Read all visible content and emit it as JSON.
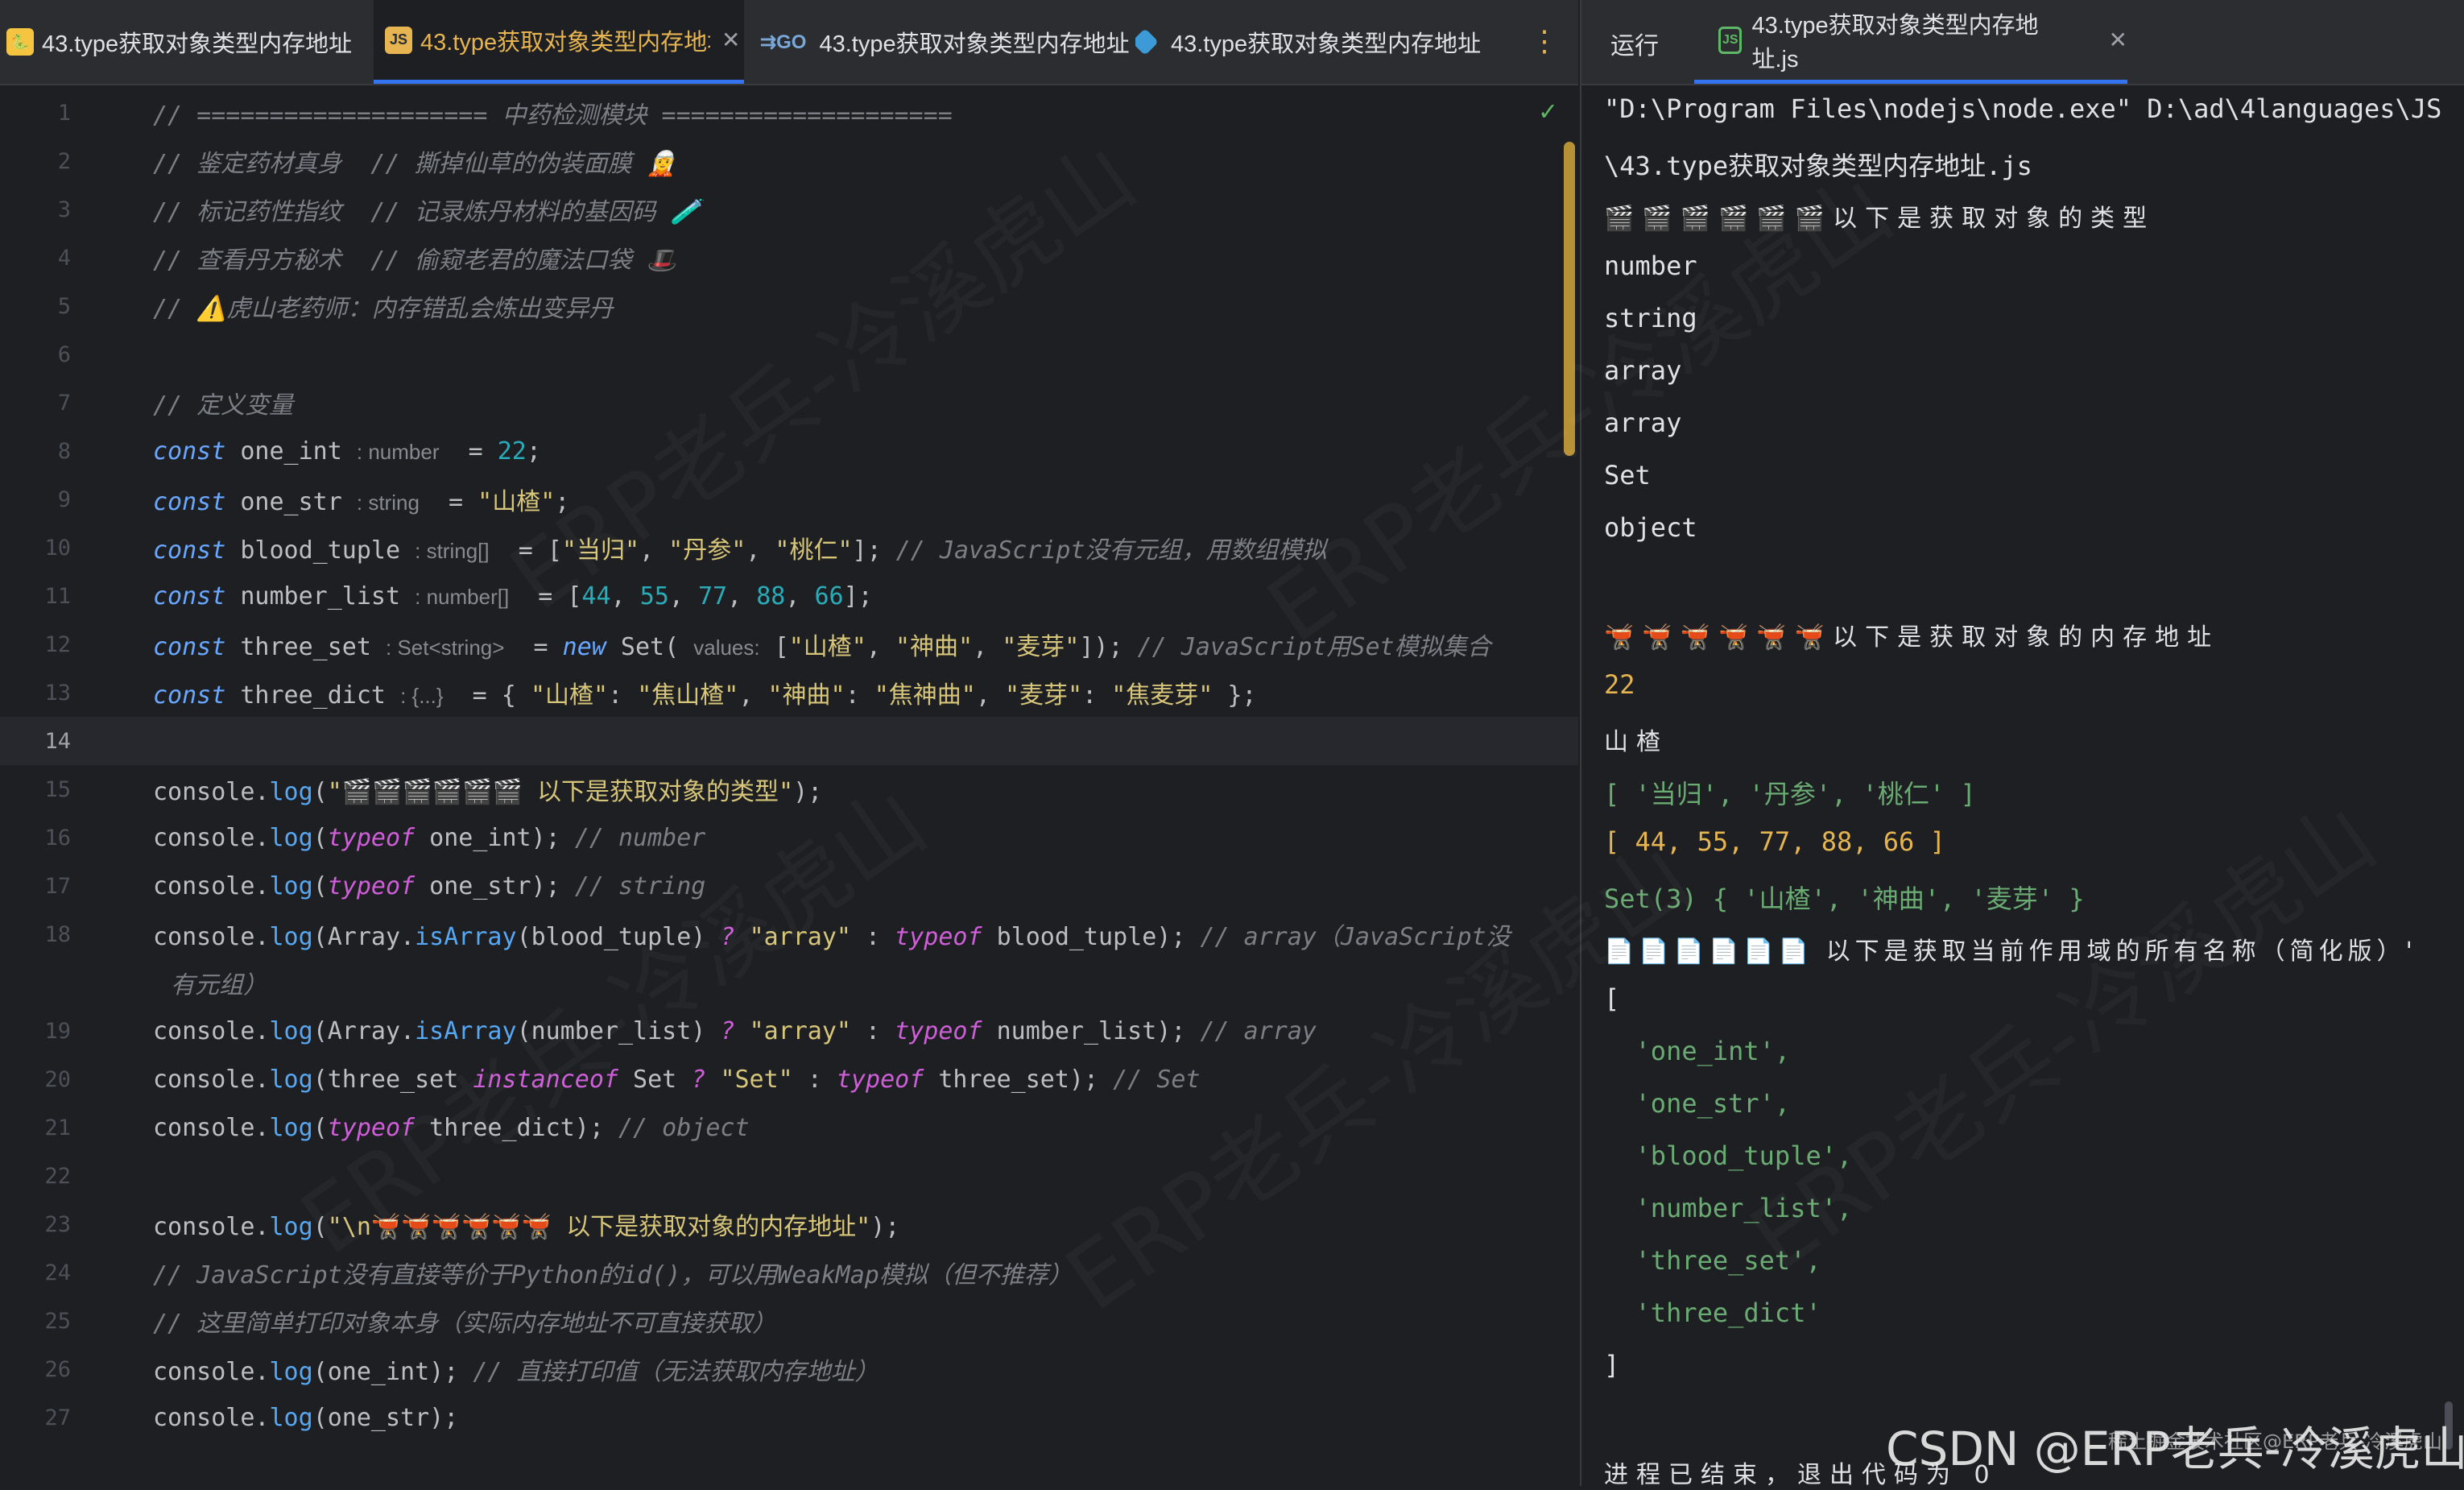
{
  "editor": {
    "tabs": [
      {
        "label": "43.type获取对象类型内存地址",
        "icon": "python-file-icon",
        "active": false,
        "closable": false
      },
      {
        "label": "43.type获取对象类型内存地址",
        "icon": "js-file-icon",
        "active": true,
        "closable": true
      },
      {
        "label": "43.type获取对象类型内存地址",
        "icon": "go-file-icon",
        "active": false,
        "closable": false
      },
      {
        "label": "43.type获取对象类型内存地址",
        "icon": "cube-file-icon",
        "active": false,
        "closable": false
      }
    ],
    "line_numbers": [
      "1",
      "2",
      "3",
      "4",
      "5",
      "6",
      "7",
      "8",
      "9",
      "10",
      "11",
      "12",
      "13",
      "14",
      "15",
      "16",
      "17",
      "18",
      "19",
      "20",
      "21",
      "22",
      "23",
      "24",
      "25",
      "26",
      "27"
    ],
    "current_line": "14",
    "code_lines": [
      "// ==================== 中药检测模块 ====================",
      "// 鉴定药材真身  // 撕掉仙草的伪装面膜 🧝",
      "// 标记药性指纹  // 记录炼丹材料的基因码 🧪",
      "// 查看丹方秘术  // 偷窥老君的魔法口袋 🎩",
      "// ⚠️虎山老药师：内存错乱会炼出变异丹",
      "",
      "// 定义变量",
      "const one_int = 22;",
      "const one_str = \"山楂\";",
      "const blood_tuple = [\"当归\", \"丹参\", \"桃仁\"]; // JavaScript没有元组，用数组模拟",
      "const number_list = [44, 55, 77, 88, 66];",
      "const three_set = new Set([\"山楂\", \"神曲\", \"麦芽\"]); // JavaScript用Set模拟集合",
      "const three_dict = { \"山楂\": \"焦山楂\", \"神曲\": \"焦神曲\", \"麦芽\": \"焦麦芽\" };",
      "",
      "console.log(\"🎬🎬🎬🎬🎬🎬 以下是获取对象的类型\");",
      "console.log(typeof one_int); // number",
      "console.log(typeof one_str); // string",
      "console.log(Array.isArray(blood_tuple) ? \"array\" : typeof blood_tuple); // array（JavaScript没有元组）",
      "console.log(Array.isArray(number_list) ? \"array\" : typeof number_list); // array",
      "console.log(three_set instanceof Set ? \"Set\" : typeof three_set); // Set",
      "console.log(typeof three_dict); // object",
      "",
      "console.log(\"\\n🫕🫕🫕🫕🫕🫕 以下是获取对象的内存地址\");",
      "// JavaScript没有直接等价于Python的id()，可以用WeakMap模拟（但不推荐）",
      "// 这里简单打印对象本身（实际内存地址不可直接获取）",
      "console.log(one_int); // 直接打印值（无法获取内存地址）",
      "console.log(one_str);"
    ],
    "inlay_hints": {
      "one_int": ": number",
      "one_str": ": string",
      "blood_tuple": ": string[]",
      "number_list": ": number[]",
      "three_set": ": Set<string>",
      "three_set_param": "values:",
      "three_dict": ": {...}"
    }
  },
  "run_panel": {
    "title": "运行",
    "tab_label": "43.type获取对象类型内存地址.js",
    "tab_icon": "nodejs-file-icon",
    "output": [
      {
        "text": "\"D:\\Program Files\\nodejs\\node.exe\" D:\\ad\\4languages\\JS",
        "kind": "plain"
      },
      {
        "text": "\\43.type获取对象类型内存地址.js",
        "kind": "plain"
      },
      {
        "text": "🎬🎬🎬🎬🎬🎬以下是获取对象的类型",
        "kind": "cjk"
      },
      {
        "text": "number",
        "kind": "plain"
      },
      {
        "text": "string",
        "kind": "plain"
      },
      {
        "text": "array",
        "kind": "plain"
      },
      {
        "text": "array",
        "kind": "plain"
      },
      {
        "text": "Set",
        "kind": "plain"
      },
      {
        "text": "object",
        "kind": "plain"
      },
      {
        "text": "",
        "kind": "plain"
      },
      {
        "text": "🫕🫕🫕🫕🫕🫕以下是获取对象的内存地址",
        "kind": "cjk"
      },
      {
        "text": "22",
        "kind": "number"
      },
      {
        "text": "山楂",
        "kind": "cjk"
      },
      {
        "text": "[ '当归', '丹参', '桃仁' ]",
        "kind": "array-str"
      },
      {
        "text": "[ 44, 55, 77, 88, 66 ]",
        "kind": "array-num"
      },
      {
        "text": "Set(3) { '山楂', '神曲', '麦芽' }",
        "kind": "set"
      },
      {
        "text": "📄📄📄📄📄📄 以下是获取当前作用域的所有名称（简化版）'",
        "kind": "cjk"
      },
      {
        "text": "[",
        "kind": "plain"
      },
      {
        "text": "  'one_int',",
        "kind": "str-line"
      },
      {
        "text": "  'one_str',",
        "kind": "str-line"
      },
      {
        "text": "  'blood_tuple',",
        "kind": "str-line"
      },
      {
        "text": "  'number_list',",
        "kind": "str-line"
      },
      {
        "text": "  'three_set',",
        "kind": "str-line"
      },
      {
        "text": "  'three_dict'",
        "kind": "str-line"
      },
      {
        "text": "]",
        "kind": "plain"
      },
      {
        "text": "",
        "kind": "plain"
      },
      {
        "text": "进程已结束，退出代码为 0",
        "kind": "cjk"
      }
    ]
  },
  "watermark": {
    "text": "ERP老兵-冷溪虎山",
    "footer": "CSDN @ERP老兵-冷溪虎山",
    "footer_small": "稀土掘金技术社区@ERP老兵-冷溪虎山"
  },
  "colors": {
    "background": "#1e1f22",
    "active_tab_text": "#e6b450",
    "keyword": "#6aa7ff",
    "string": "#d7c67a",
    "number": "#2aacb8",
    "comment": "#7a7e85",
    "output_string": "#6aab73",
    "output_number": "#e6b450",
    "accent": "#3574f0"
  }
}
